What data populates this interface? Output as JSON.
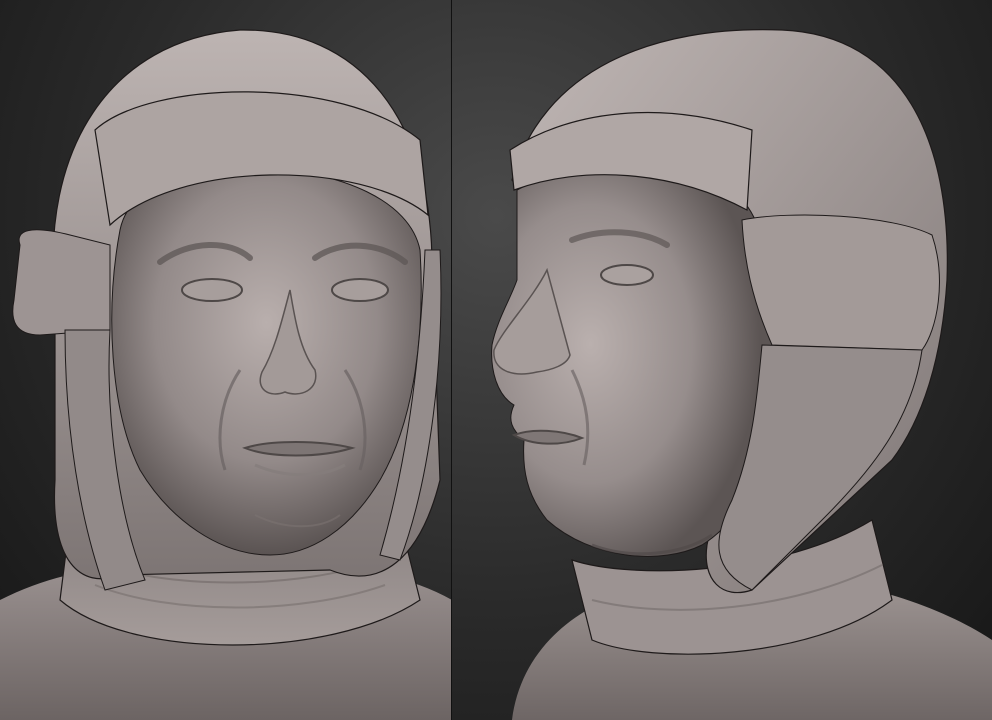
{
  "scene": {
    "views": [
      {
        "name": "front-view"
      },
      {
        "name": "three-quarter-view"
      }
    ],
    "colors": {
      "background_top": "#4a4a4a",
      "background_bottom": "#161616",
      "clay_light": "#b4aaa8",
      "clay_mid": "#8d8483",
      "clay_dark": "#4e4847",
      "seam_line": "#1e1a1a"
    }
  }
}
